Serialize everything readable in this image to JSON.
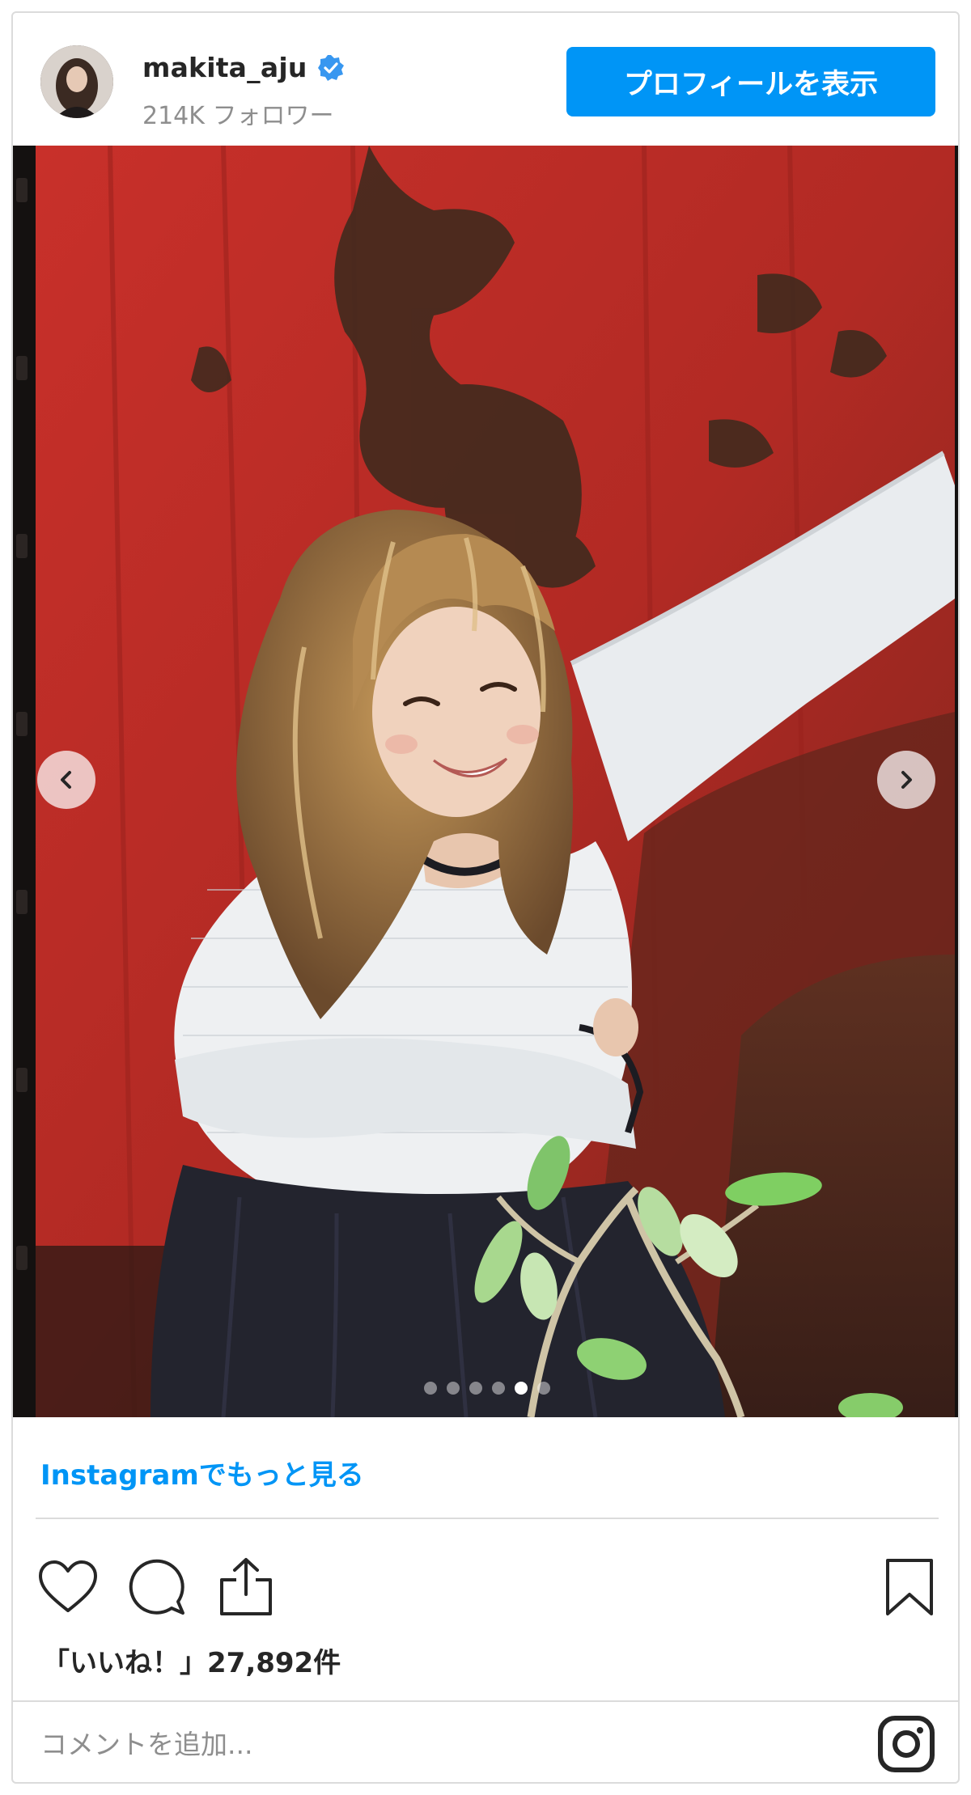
{
  "header": {
    "username": "makita_aju",
    "verified_icon": "verified-badge-icon",
    "followers": "214K フォロワー",
    "profile_button": "プロフィールを表示"
  },
  "carousel": {
    "total_slides": 6,
    "active_slide": 5,
    "prev_icon": "chevron-left-icon",
    "next_icon": "chevron-right-icon"
  },
  "footer": {
    "more_link": "Instagramでもっと見る",
    "likes": "「いいね！」27,892件",
    "comment_placeholder": "コメントを追加...",
    "icons": [
      "heart-icon",
      "comment-icon",
      "share-icon",
      "bookmark-icon",
      "instagram-logo-icon"
    ]
  },
  "colors": {
    "accent": "#0095f6",
    "border": "#dbdbdb",
    "muted_text": "#8e8e8e",
    "verified": "#3897f0"
  }
}
